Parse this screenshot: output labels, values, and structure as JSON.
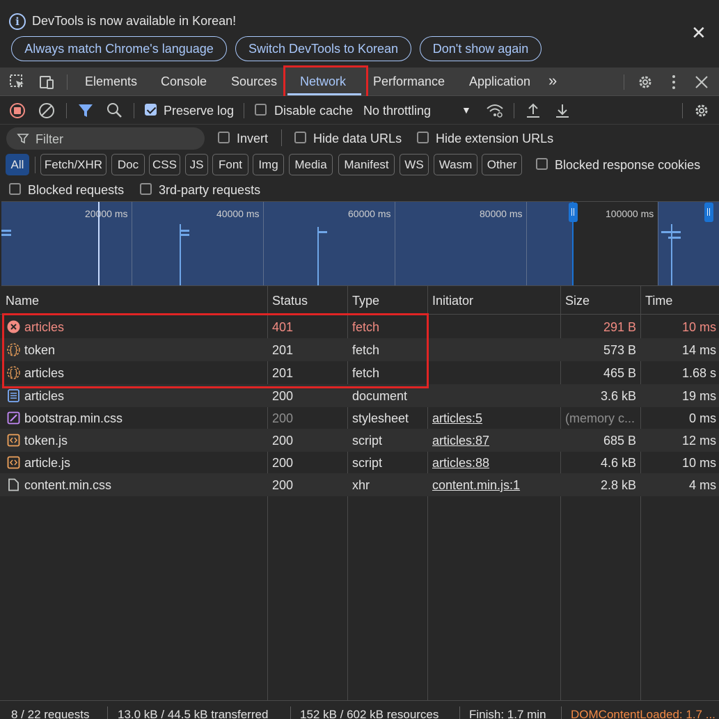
{
  "infobar": {
    "message": "DevTools is now available in Korean!",
    "buttons": [
      "Always match Chrome's language",
      "Switch DevTools to Korean",
      "Don't show again"
    ],
    "close_icon": "close-icon"
  },
  "tabs": {
    "items": [
      "Elements",
      "Console",
      "Sources",
      "Network",
      "Performance",
      "Application"
    ],
    "active": "Network"
  },
  "toolbar": {
    "preserve_log": "Preserve log",
    "preserve_log_checked": true,
    "disable_cache": "Disable cache",
    "throttling": "No throttling"
  },
  "filters": {
    "placeholder": "Filter",
    "invert": "Invert",
    "hide_data_urls": "Hide data URLs",
    "hide_extension_urls": "Hide extension URLs",
    "types": [
      "All",
      "Fetch/XHR",
      "Doc",
      "CSS",
      "JS",
      "Font",
      "Img",
      "Media",
      "Manifest",
      "WS",
      "Wasm",
      "Other"
    ],
    "active_type": "All",
    "blocked_response_cookies": "Blocked response cookies",
    "blocked_requests": "Blocked requests",
    "third_party_requests": "3rd-party requests"
  },
  "overview": {
    "ticks": [
      "20000 ms",
      "40000 ms",
      "60000 ms",
      "80000 ms",
      "100000 ms"
    ]
  },
  "table": {
    "columns": [
      "Name",
      "Status",
      "Type",
      "Initiator",
      "Size",
      "Time"
    ],
    "rows": [
      {
        "icon": "error-icon",
        "name": "articles",
        "status": "401",
        "type": "fetch",
        "initiator": "",
        "size": "291 B",
        "time": "10 ms",
        "error": true
      },
      {
        "icon": "fetch-icon",
        "name": "token",
        "status": "201",
        "type": "fetch",
        "initiator": "",
        "size": "573 B",
        "time": "14 ms"
      },
      {
        "icon": "fetch-icon",
        "name": "articles",
        "status": "201",
        "type": "fetch",
        "initiator": "",
        "size": "465 B",
        "time": "1.68 s"
      },
      {
        "icon": "document-icon",
        "name": "articles",
        "status": "200",
        "type": "document",
        "initiator": "",
        "size": "3.6 kB",
        "time": "19 ms"
      },
      {
        "icon": "stylesheet-icon",
        "name": "bootstrap.min.css",
        "status": "200",
        "type": "stylesheet",
        "initiator": "articles:5",
        "size": "(memory c...",
        "time": "0 ms",
        "cached": true
      },
      {
        "icon": "script-icon",
        "name": "token.js",
        "status": "200",
        "type": "script",
        "initiator": "articles:87",
        "size": "685 B",
        "time": "12 ms"
      },
      {
        "icon": "script-icon",
        "name": "article.js",
        "status": "200",
        "type": "script",
        "initiator": "articles:88",
        "size": "4.6 kB",
        "time": "10 ms"
      },
      {
        "icon": "file-icon",
        "name": "content.min.css",
        "status": "200",
        "type": "xhr",
        "initiator": "content.min.js:1",
        "size": "2.8 kB",
        "time": "4 ms"
      }
    ]
  },
  "statusbar": {
    "requests": "8 / 22 requests",
    "transferred": "13.0 kB / 44.5 kB transferred",
    "resources": "152 kB / 602 kB resources",
    "finish": "Finish: 1.7 min",
    "dom_content_loaded": "DOMContentLoaded: 1.7 ..."
  },
  "colors": {
    "accent": "#a8c7fa",
    "error": "#f28b82",
    "highlight_box": "#e02424",
    "dom_content_loaded": "#f48a45"
  }
}
